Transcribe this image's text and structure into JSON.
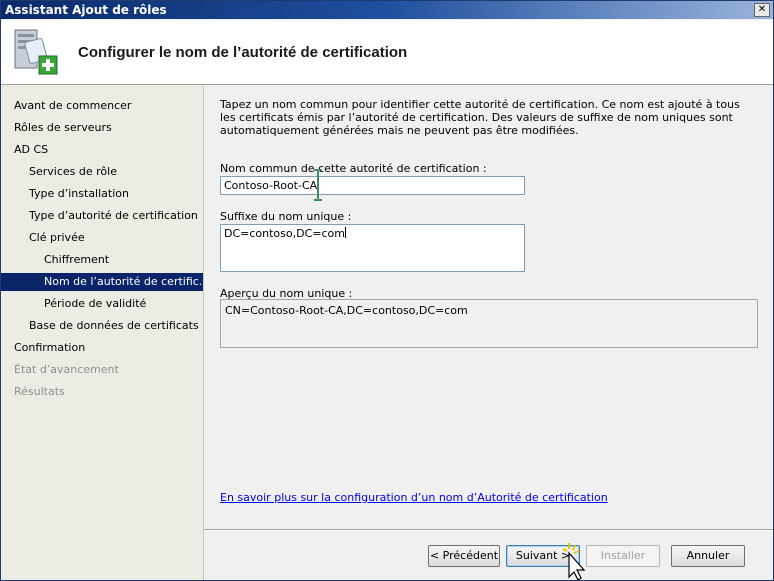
{
  "window": {
    "title": "Assistant Ajout de rôles",
    "close_glyph": "✕"
  },
  "header": {
    "title": "Configurer le nom de l’autorité de certification",
    "icon": "server-roles-add-icon"
  },
  "sidebar": {
    "items": [
      {
        "label": "Avant de commencer",
        "state": "normal"
      },
      {
        "label": "Rôles de serveurs",
        "state": "normal"
      },
      {
        "label": "AD CS",
        "state": "normal"
      },
      {
        "label": "Services de rôle",
        "state": "normal"
      },
      {
        "label": "Type d’installation",
        "state": "normal"
      },
      {
        "label": "Type d’autorité de certification",
        "state": "normal"
      },
      {
        "label": "Clé privée",
        "state": "normal"
      },
      {
        "label": "Chiffrement",
        "state": "normal"
      },
      {
        "label": "Nom de l’autorité de certific...",
        "state": "selected"
      },
      {
        "label": "Période de validité",
        "state": "normal"
      },
      {
        "label": "Base de données de certificats",
        "state": "normal"
      },
      {
        "label": "Confirmation",
        "state": "normal"
      },
      {
        "label": "État d’avancement",
        "state": "disabled"
      },
      {
        "label": "Résultats",
        "state": "disabled"
      }
    ]
  },
  "main": {
    "description": "Tapez un nom commun pour identifier cette autorité de certification. Ce nom est ajouté à tous les certificats émis par l’autorité de certification. Des valeurs de suffixe de nom uniques sont automatiquement générées mais ne peuvent pas être modifiées.",
    "common_name_label": "Nom commun de cette autorité de certification :",
    "common_name_value": "Contoso-Root-CA",
    "suffix_label": "Suffixe du nom unique :",
    "suffix_value": "DC=contoso,DC=com",
    "preview_label": "Aperçu du nom unique :",
    "preview_value": "CN=Contoso-Root-CA,DC=contoso,DC=com",
    "help_link": "En savoir plus sur la configuration d’un nom d’Autorité de certification"
  },
  "footer": {
    "previous_label": "< Précédent",
    "next_label": "Suivant >",
    "install_label": "Installer",
    "cancel_label": "Annuler"
  },
  "colors": {
    "selection": "#0a246a",
    "link": "#0000ee",
    "titlebar": "#1f4f9e"
  }
}
